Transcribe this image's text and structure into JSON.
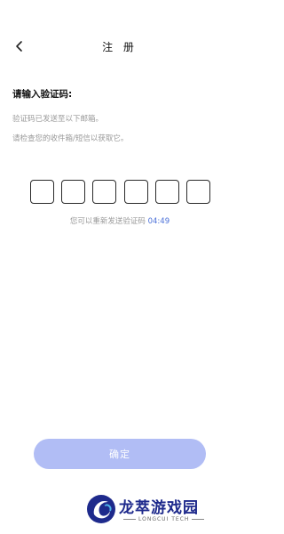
{
  "header": {
    "back_icon": "chevron-left-icon",
    "title": "注 册"
  },
  "prompt": {
    "title": "请输入验证码:",
    "info_line1": "验证码已发送至以下邮箱。",
    "info_line2": "请检查您的收件箱/短信以获取它。"
  },
  "code_inputs": [
    "",
    "",
    "",
    "",
    "",
    ""
  ],
  "resend": {
    "text": "您可以重新发送验证码",
    "countdown": "04:49",
    "countdown_color": "#4a6fd8"
  },
  "confirm_button": {
    "label": "确定",
    "color": "#b1bdf5"
  },
  "watermark": {
    "name": "龙萃游戏园",
    "subtitle": "LONGCUI TECH",
    "color": "#1e2a8c"
  }
}
